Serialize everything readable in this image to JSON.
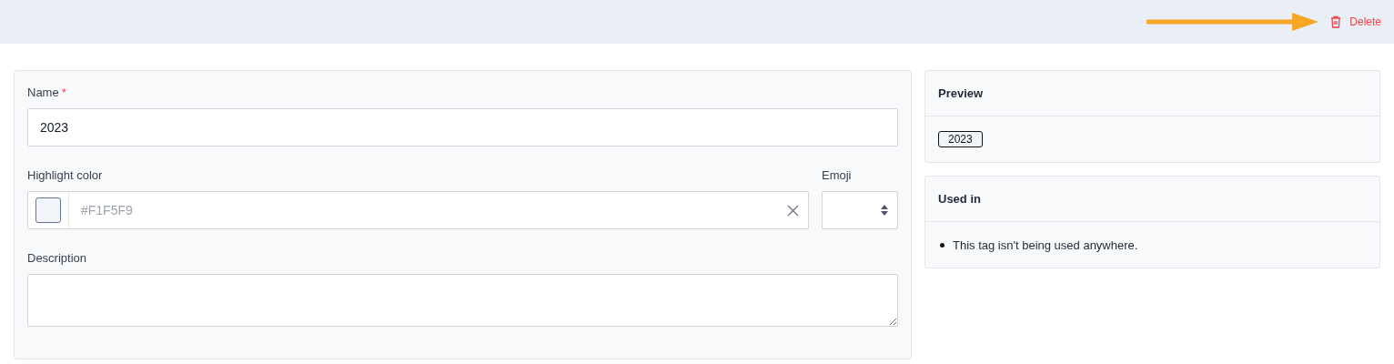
{
  "header": {
    "delete_label": "Delete"
  },
  "form": {
    "name": {
      "label": "Name",
      "required_mark": "*",
      "value": "2023"
    },
    "highlight_color": {
      "label": "Highlight color",
      "placeholder": "#F1F5F9"
    },
    "emoji": {
      "label": "Emoji"
    },
    "description": {
      "label": "Description"
    }
  },
  "preview": {
    "title": "Preview",
    "tag": "2023"
  },
  "used_in": {
    "title": "Used in",
    "items": [
      "This tag isn't being used anywhere."
    ]
  }
}
